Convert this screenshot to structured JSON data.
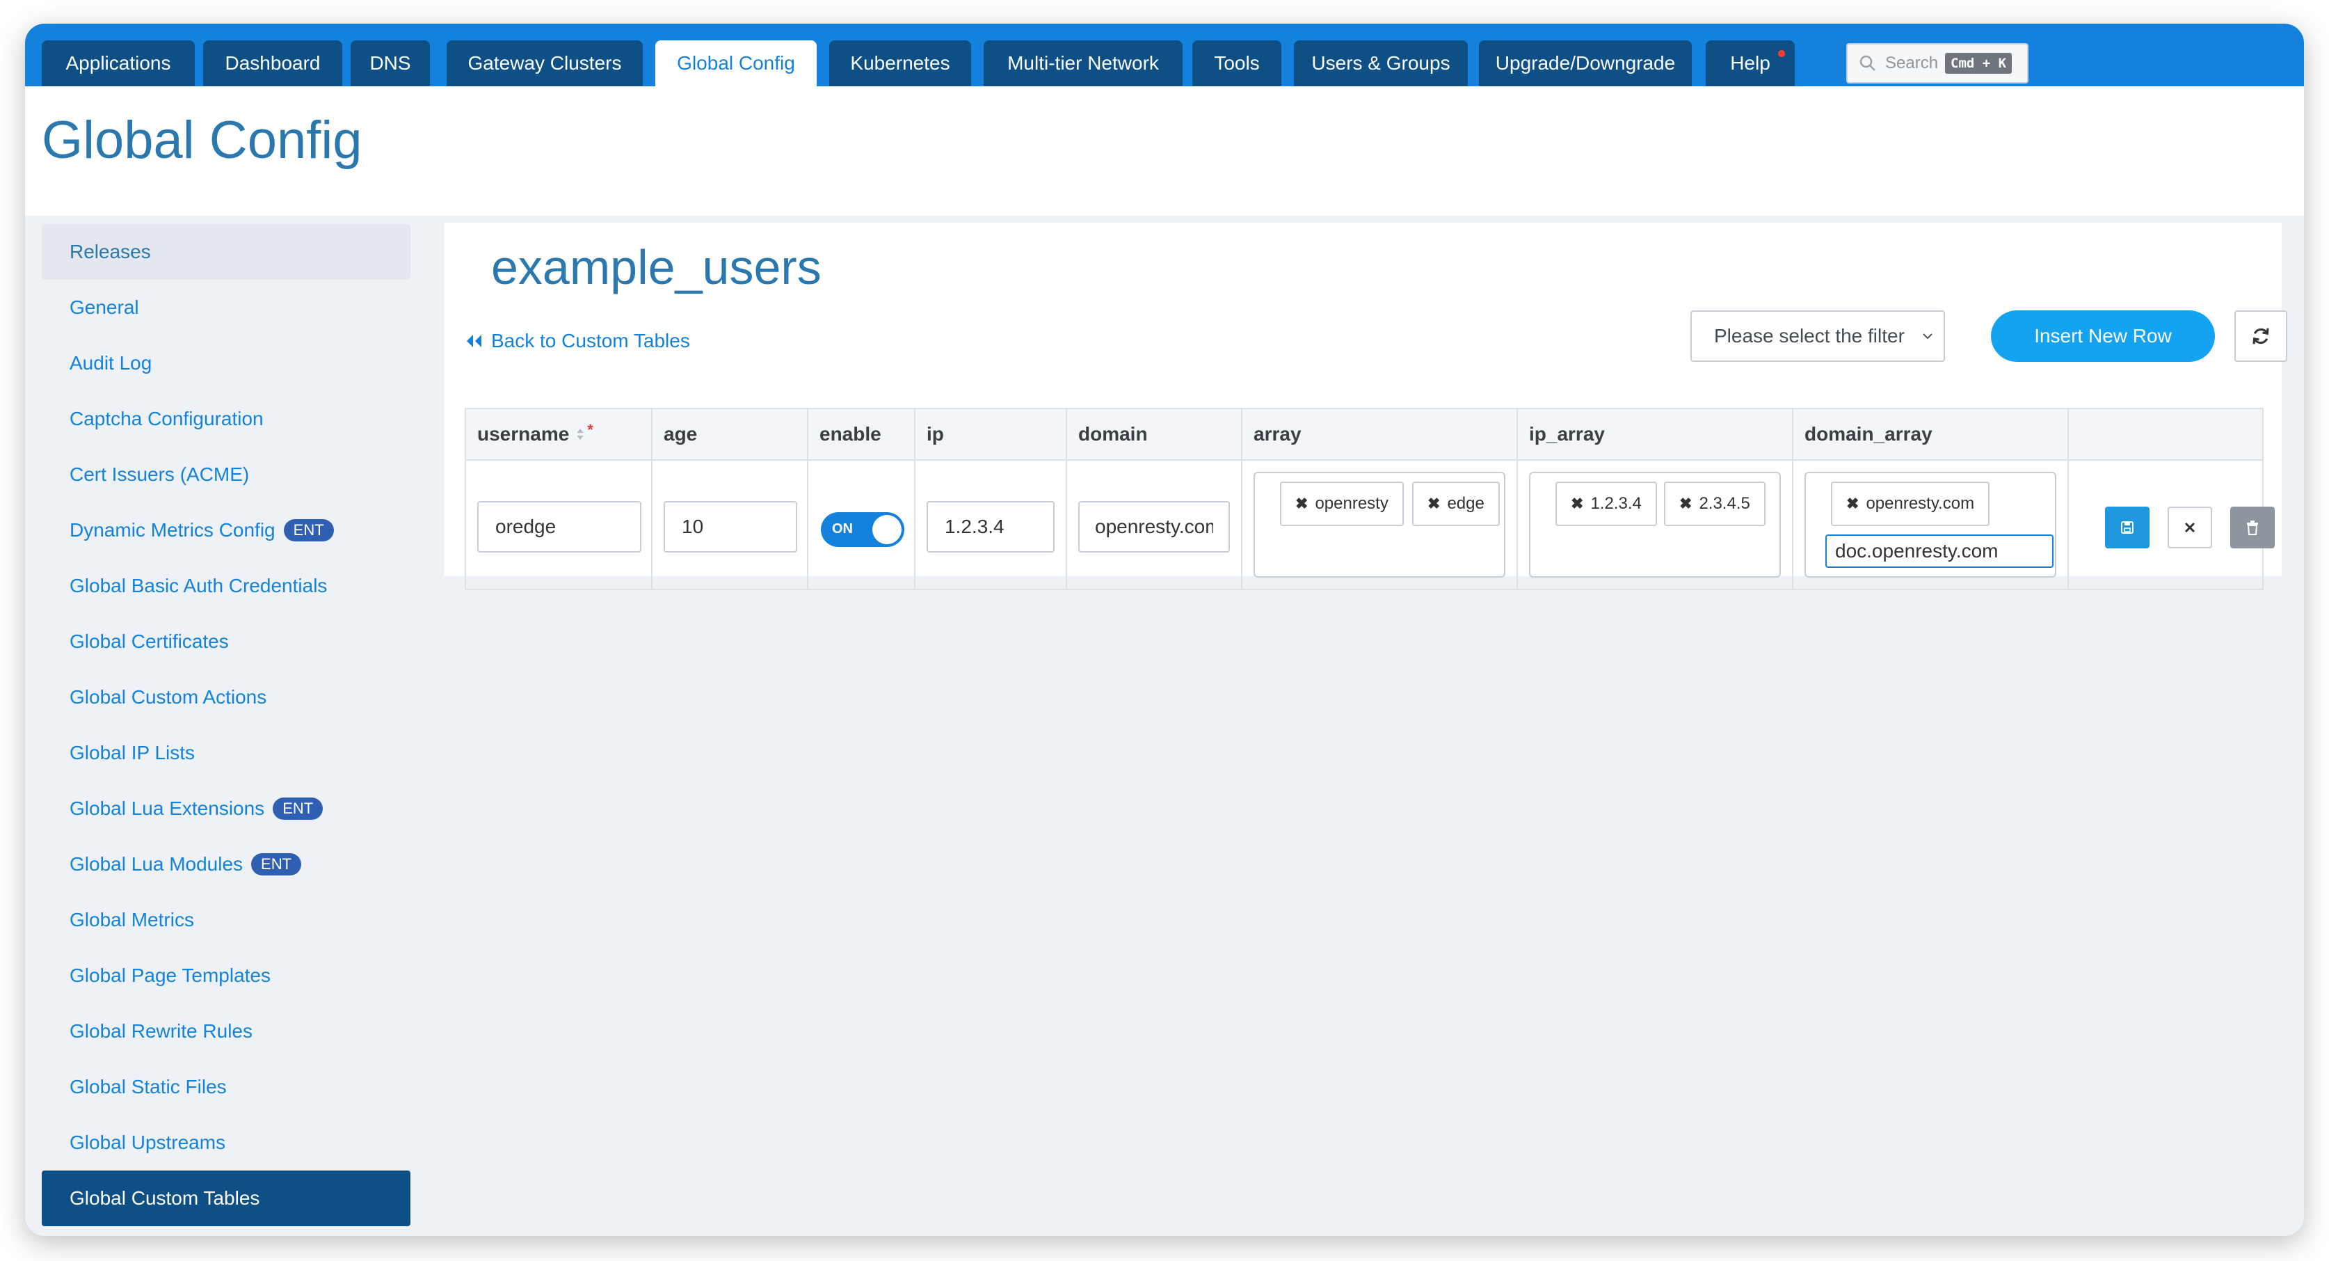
{
  "nav": {
    "tabs": [
      {
        "label": "Applications"
      },
      {
        "label": "Dashboard"
      },
      {
        "label": "DNS"
      },
      {
        "label": "Gateway Clusters"
      },
      {
        "label": "Global Config"
      },
      {
        "label": "Kubernetes"
      },
      {
        "label": "Multi-tier Network"
      },
      {
        "label": "Tools"
      },
      {
        "label": "Users & Groups"
      },
      {
        "label": "Upgrade/Downgrade"
      },
      {
        "label": "Help"
      }
    ],
    "active_tab": "Global Config",
    "search": {
      "placeholder": "Search",
      "shortcut": "Cmd + K"
    }
  },
  "page": {
    "title": "Global Config"
  },
  "sidebar": {
    "items": [
      {
        "label": "Releases"
      },
      {
        "label": "General"
      },
      {
        "label": "Audit Log"
      },
      {
        "label": "Captcha Configuration"
      },
      {
        "label": "Cert Issuers (ACME)"
      },
      {
        "label": "Dynamic Metrics Config",
        "badge": "ENT"
      },
      {
        "label": "Global Basic Auth Credentials"
      },
      {
        "label": "Global Certificates"
      },
      {
        "label": "Global Custom Actions"
      },
      {
        "label": "Global IP Lists"
      },
      {
        "label": "Global Lua Extensions",
        "badge": "ENT"
      },
      {
        "label": "Global Lua Modules",
        "badge": "ENT"
      },
      {
        "label": "Global Metrics"
      },
      {
        "label": "Global Page Templates"
      },
      {
        "label": "Global Rewrite Rules"
      },
      {
        "label": "Global Static Files"
      },
      {
        "label": "Global Upstreams"
      },
      {
        "label": "Global Custom Tables"
      }
    ],
    "active_item": "Global Custom Tables"
  },
  "main": {
    "table_name": "example_users",
    "back_link": "Back to Custom Tables",
    "filter_placeholder": "Please select the filter",
    "insert_button": "Insert New Row",
    "columns": [
      "username",
      "age",
      "enable",
      "ip",
      "domain",
      "array",
      "ip_array",
      "domain_array"
    ],
    "required_mark": "*",
    "row": {
      "username": "oredge",
      "age": "10",
      "enable_label": "ON",
      "ip": "1.2.3.4",
      "domain": "openresty.com",
      "array": [
        "openresty",
        "edge"
      ],
      "ip_array": [
        "1.2.3.4",
        "2.3.4.5"
      ],
      "domain_array": [
        "openresty.com"
      ],
      "domain_array_input": "doc.openresty.com"
    }
  },
  "colors": {
    "topbar": "#1482dd",
    "tab_bg": "#0e4f85",
    "title": "#2a78ad",
    "link": "#1482dd",
    "primary_button": "#14a3f0",
    "badge": "#2e5fb3"
  }
}
